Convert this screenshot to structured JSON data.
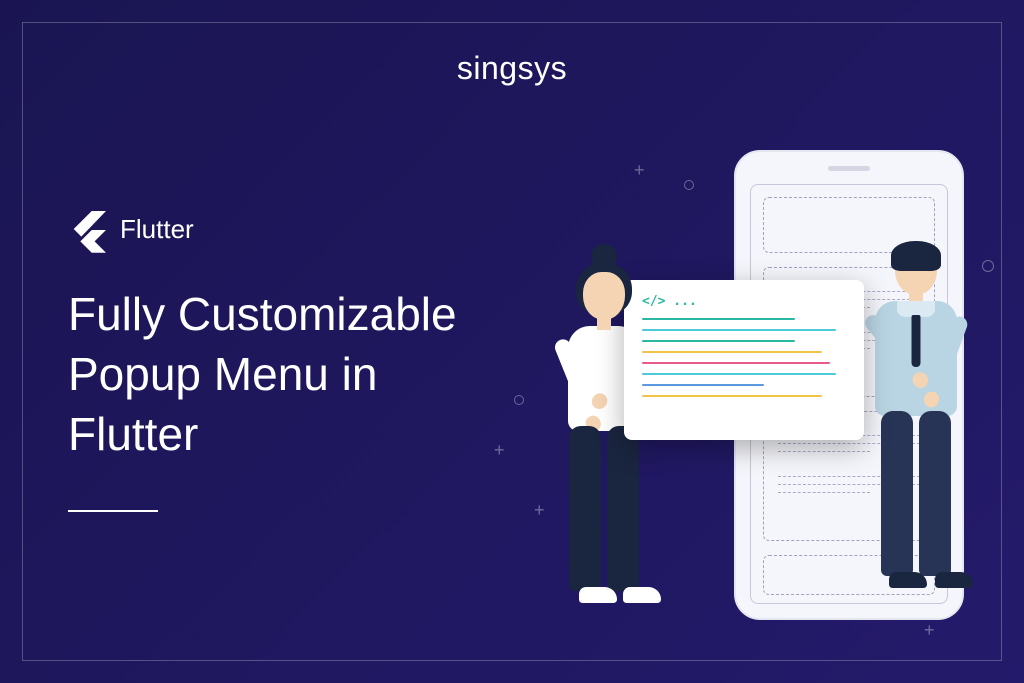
{
  "brand": "singsys",
  "tech": {
    "label": "Flutter"
  },
  "headline": {
    "line1": "Fully Customizable",
    "line2": "Popup Menu in",
    "line3": "Flutter"
  },
  "code_card": {
    "tag": "</> ..."
  },
  "colors": {
    "bg_start": "#1a1552",
    "bg_end": "#241a6b",
    "teal": "#2bb8a3",
    "cyan": "#4ec9d6",
    "yellow": "#f0c447",
    "pink": "#e85a8c",
    "blue": "#5a9be0"
  }
}
